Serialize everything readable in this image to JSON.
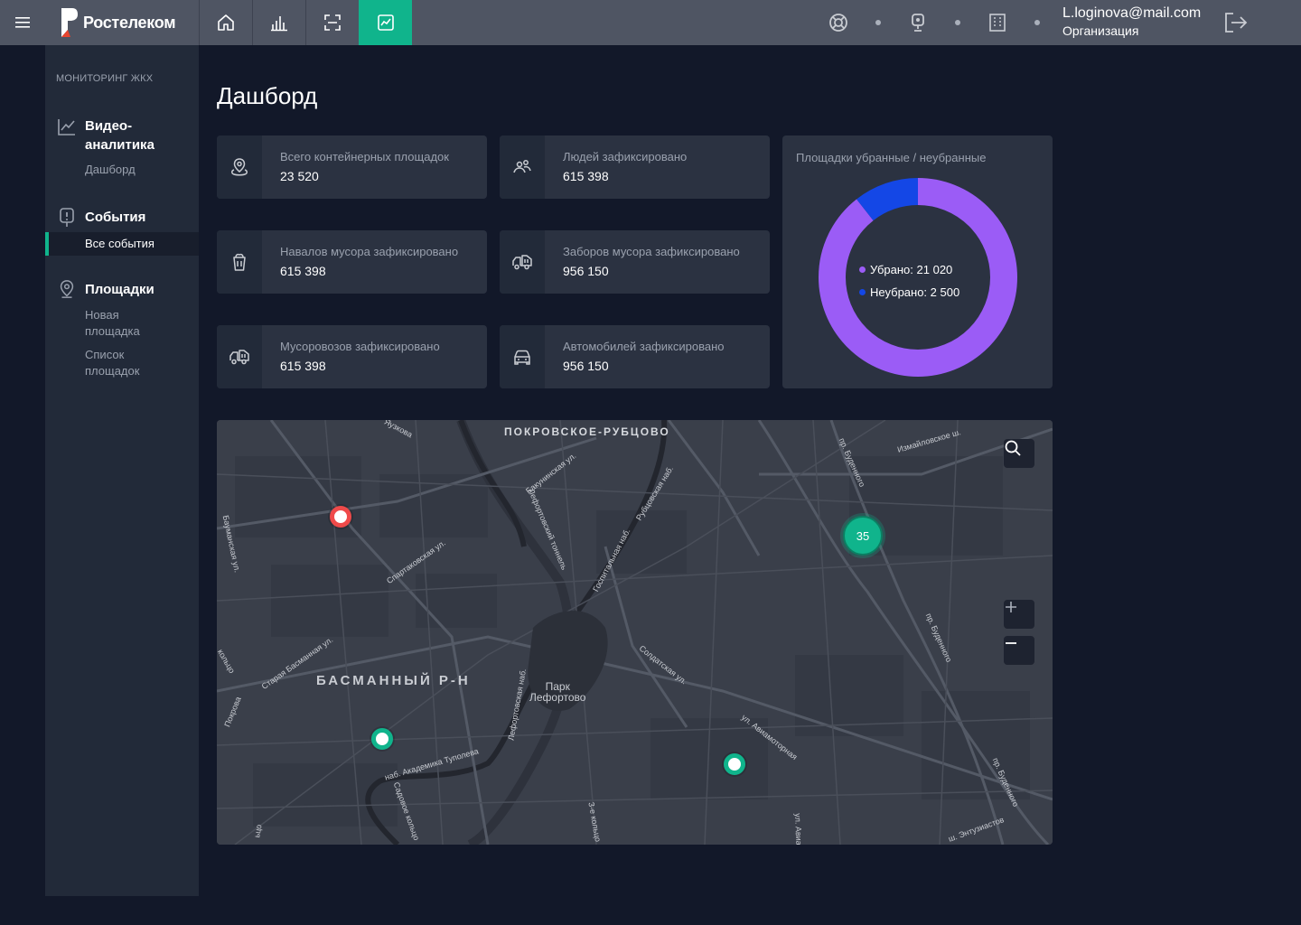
{
  "brand": {
    "name": "Ростелеком",
    "accent": "#10b48c",
    "logo_red": "#e8442e"
  },
  "topbar": {
    "icons": [
      "home-icon",
      "bar-chart-icon",
      "scan-icon",
      "trend-chart-icon"
    ],
    "right_icons": [
      "lifebuoy-icon",
      "camera-icon",
      "building-icon"
    ],
    "user_email": "L.loginova@mail.com",
    "user_org": "Организация"
  },
  "sidebar": {
    "title": "МОНИТОРИНГ ЖКХ",
    "groups": [
      {
        "label_line1": "Видео-",
        "label_line2": "аналитика",
        "icon": "analytics-icon",
        "items": [
          "Дашборд"
        ]
      },
      {
        "label": "События",
        "icon": "alert-icon",
        "items": [
          "Все события"
        ]
      },
      {
        "label": "Площадки",
        "icon": "location-pin-icon",
        "items_line": [
          "Новая",
          "площадка",
          "Список",
          "площадок"
        ]
      }
    ]
  },
  "page": {
    "title": "Дашборд"
  },
  "cards": [
    {
      "label": "Всего контейнерных площадок",
      "value": "23 520",
      "icon": "location-icon"
    },
    {
      "label": "Людей зафиксировано",
      "value": "615 398",
      "icon": "people-icon"
    },
    {
      "label": "Навалов мусора зафиксировано",
      "value": "615 398",
      "icon": "trash-bin-icon"
    },
    {
      "label": "Заборов мусора зафиксировано",
      "value": "956 150",
      "icon": "garbage-truck-icon"
    },
    {
      "label": "Мусоровозов зафиксировано",
      "value": "615 398",
      "icon": "garbage-truck-icon"
    },
    {
      "label": "Автомобилей зафиксировано",
      "value": "956 150",
      "icon": "car-icon"
    }
  ],
  "donut": {
    "title": "Площадки убранные / неубранные",
    "legend": [
      {
        "label": "Убрано: 21 020",
        "color": "#9b5cf6"
      },
      {
        "label": "Неубрано: 2 500",
        "color": "#1447e6"
      }
    ],
    "chart_data": {
      "type": "pie",
      "categories": [
        "Убрано",
        "Неубрано"
      ],
      "values": [
        21020,
        2500
      ]
    }
  },
  "map": {
    "area_label": "ПОКРОВСКОЕ-РУБЦОВО",
    "district_label": "БАСМАННЫЙ Р-Н",
    "park_line1": "Парк",
    "park_line2": "Лефортово",
    "streets": [
      "Бакунинская ул.",
      "Лефортовский тоннель",
      "Рубцовская наб.",
      "Госпитальная наб.",
      "Спартаковская ул.",
      "Старая Басманная ул.",
      "Солдатская ул.",
      "ул. Авиамоторная",
      "наб. Академика Туполева",
      "Лефортовская наб.",
      "пр. Буденного",
      "Измайловское ш.",
      "ш. Энтузиастов",
      "3-е кольцо",
      "ул. Авиа",
      "Покрова",
      "кольцо",
      "ьцо",
      "Яузкова",
      "Садовое кольцо",
      "Бауманская ул."
    ],
    "cluster_count": "35",
    "controls": [
      "search-icon",
      "zoom-in-icon",
      "zoom-out-icon"
    ],
    "marker_colors": {
      "alert": "#ef4a4a",
      "ok": "#10b48c"
    }
  }
}
